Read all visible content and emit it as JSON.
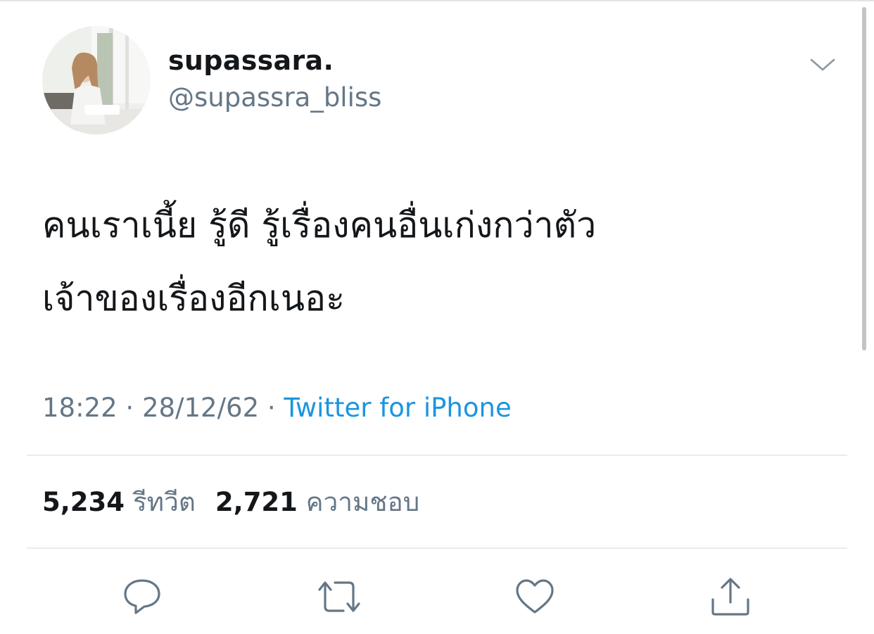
{
  "user": {
    "display_name": "supassara.",
    "handle": "@supassra_bliss"
  },
  "tweet": {
    "text_lines": [
      "คนเราเนี้ย รู้ดี รู้เรื่องคนอื่นเก่งกว่าตัว",
      "เจ้าของเรื่องอีกเนอะ"
    ],
    "time": "18:22",
    "separator": " · ",
    "date": "28/12/62",
    "source_separator": " · ",
    "source": "Twitter for iPhone"
  },
  "stats": {
    "retweets_count": "5,234",
    "retweets_label": "รีทวีต",
    "likes_count": "2,721",
    "likes_label": "ความชอบ"
  },
  "icons": {
    "more": "chevron-down-icon",
    "reply": "reply-icon",
    "retweet": "retweet-icon",
    "like": "heart-icon",
    "share": "share-icon"
  },
  "colors": {
    "text_primary": "#14171a",
    "text_secondary": "#657786",
    "link": "#1b95e0",
    "divider": "#e6ecf0",
    "icon": "#657786"
  }
}
